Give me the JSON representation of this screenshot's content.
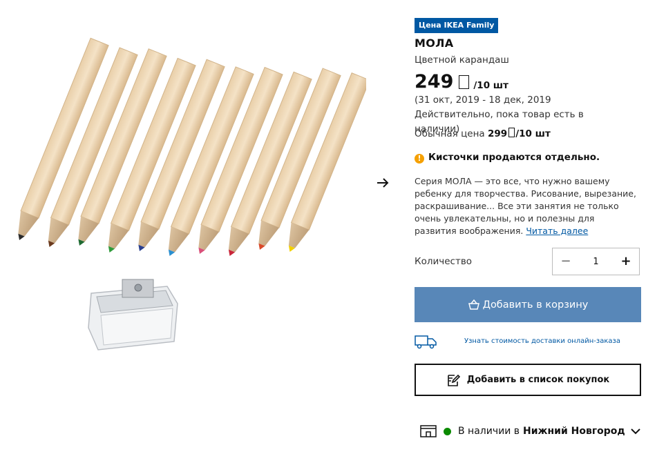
{
  "product": {
    "badge": "Цена IKEA Family",
    "name": "МОЛА",
    "description": "Цветной карандаш",
    "price": "249",
    "price_unit": "/10 шт",
    "validity": "(31 окт, 2019 - 18 дек, 2019 Действительно, пока товар есть в наличии)",
    "regular_price_label": "Обычная цена",
    "regular_price": "299",
    "regular_price_unit": "/10 шт",
    "warning": "Кисточки продаются отдельно.",
    "long_description": "Серия МОЛА — это все, что нужно вашему ребенку для творчества. Рисование, вырезание, раскрашивание... Все эти занятия не только очень увлекательны, но и полезны для развития воображения.",
    "read_more": "Читать далее"
  },
  "quantity": {
    "label": "Количество",
    "value": "1",
    "minus": "−",
    "plus": "+"
  },
  "actions": {
    "add_to_cart": "Добавить в корзину",
    "delivery_link": "Узнать стоимость доставки онлайн-заказа",
    "add_to_list": "Добавить в список покупок"
  },
  "availability": {
    "prefix": "В наличии в",
    "store": "Нижний Новгород"
  },
  "pencil_tip_colors": [
    "#2b2b2b",
    "#6b3a1e",
    "#1f6a32",
    "#2f9a3a",
    "#2a3f8e",
    "#2a8fd0",
    "#d9507a",
    "#c9263a",
    "#d94a2a",
    "#f2d000"
  ],
  "colors": {
    "brand_blue": "#0058a3",
    "cart_button": "#5887b8",
    "in_stock": "#0a8a00",
    "warning": "#f5a000"
  }
}
